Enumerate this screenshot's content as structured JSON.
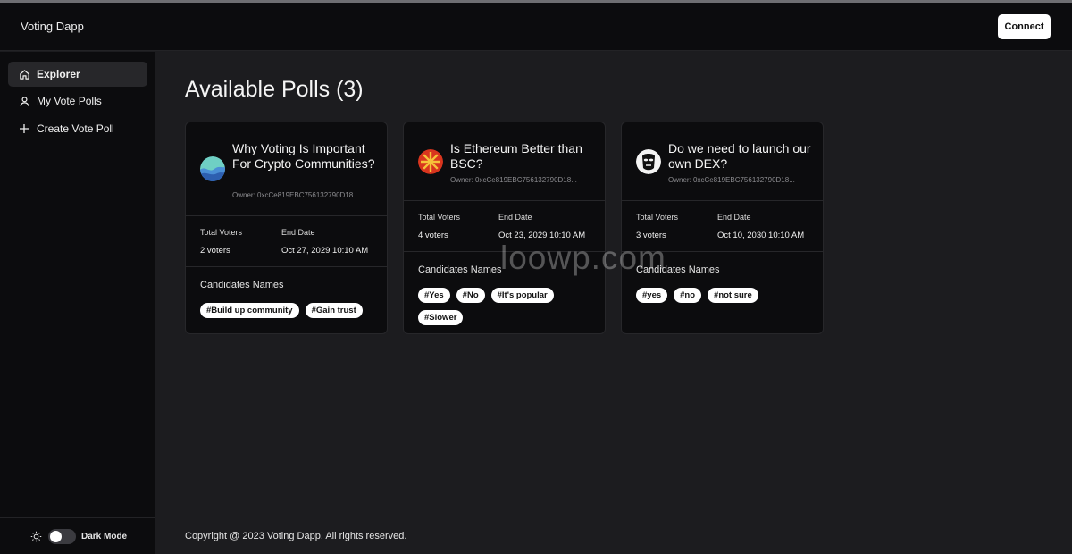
{
  "app": {
    "title": "Voting Dapp"
  },
  "header": {
    "connect_label": "Connect"
  },
  "sidebar": {
    "items": [
      {
        "label": "Explorer",
        "icon": "home-icon",
        "active": true
      },
      {
        "label": "My Vote Polls",
        "icon": "user-icon",
        "active": false
      },
      {
        "label": "Create Vote Poll",
        "icon": "plus-icon",
        "active": false
      }
    ],
    "dark_mode_label": "Dark Mode",
    "dark_mode_on": false
  },
  "main": {
    "title": "Available Polls (3)",
    "polls": [
      {
        "question": "Why Voting Is Important For Crypto Communities?",
        "owner": "Owner: 0xcCe819EBC756132790D18...",
        "total_voters_label": "Total Voters",
        "total_voters": "2 voters",
        "end_date_label": "End Date",
        "end_date": "Oct 27, 2029 10:10 AM",
        "candidates_label": "Candidates Names",
        "candidates": [
          "#Build up community",
          "#Gain trust"
        ],
        "avatar_icon": "wave-avatar-icon"
      },
      {
        "question": "Is Ethereum Better than BSC?",
        "owner": "Owner: 0xcCe819EBC756132790D18...",
        "total_voters_label": "Total Voters",
        "total_voters": "4 voters",
        "end_date_label": "End Date",
        "end_date": "Oct 23, 2029 10:10 AM",
        "candidates_label": "Candidates Names",
        "candidates": [
          "#Yes",
          "#No",
          "#It's popular",
          "#Slower"
        ],
        "avatar_icon": "sunburst-avatar-icon"
      },
      {
        "question": "Do we need to launch our own DEX?",
        "owner": "Owner: 0xcCe819EBC756132790D18...",
        "total_voters_label": "Total Voters",
        "total_voters": "3 voters",
        "end_date_label": "End Date",
        "end_date": "Oct 10, 2030 10:10 AM",
        "candidates_label": "Candidates Names",
        "candidates": [
          "#yes",
          "#no",
          "#not sure"
        ],
        "avatar_icon": "mask-avatar-icon"
      }
    ]
  },
  "footer": {
    "copyright": "Copyright @ 2023 Voting Dapp. All rights reserved."
  },
  "watermark": "loowp.com"
}
